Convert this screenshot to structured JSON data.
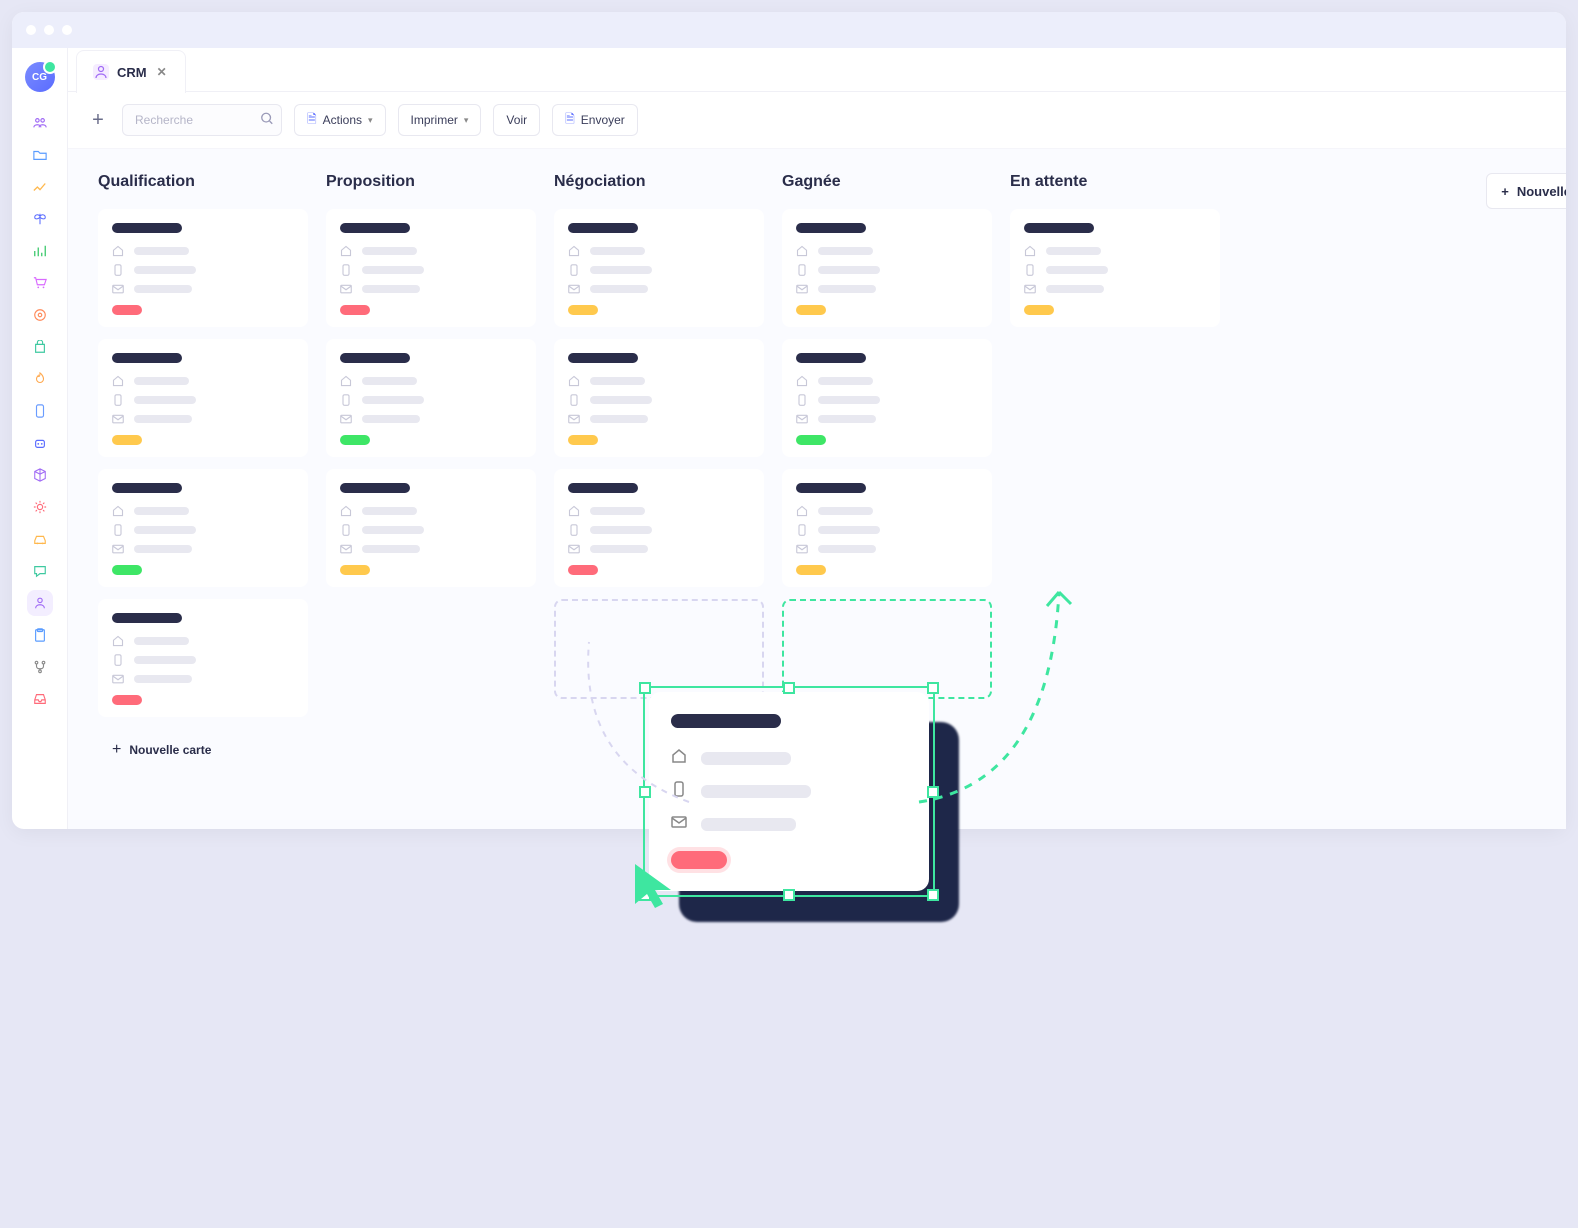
{
  "avatar": {
    "initials": "CG"
  },
  "tab": {
    "label": "CRM"
  },
  "toolbar": {
    "search_placeholder": "Recherche",
    "actions": "Actions",
    "print": "Imprimer",
    "view": "Voir",
    "send": "Envoyer"
  },
  "columns": [
    {
      "title": "Qualification",
      "cards": [
        {
          "pill": "red"
        },
        {
          "pill": "yellow"
        },
        {
          "pill": "green"
        },
        {
          "pill": "red"
        }
      ],
      "show_new_card": true
    },
    {
      "title": "Proposition",
      "cards": [
        {
          "pill": "red"
        },
        {
          "pill": "green"
        },
        {
          "pill": "yellow"
        }
      ]
    },
    {
      "title": "Négociation",
      "cards": [
        {
          "pill": "yellow"
        },
        {
          "pill": "yellow"
        },
        {
          "pill": "red"
        }
      ],
      "placeholder": "grey"
    },
    {
      "title": "Gagnée",
      "cards": [
        {
          "pill": "yellow"
        },
        {
          "pill": "green"
        },
        {
          "pill": "yellow"
        }
      ],
      "placeholder": "green"
    },
    {
      "title": "En attente",
      "cards": [
        {
          "pill": "yellow"
        }
      ]
    }
  ],
  "new_card_label": "Nouvelle carte",
  "new_column_label": "Nouvelle",
  "sidebar_icons": [
    {
      "name": "users-icon",
      "color": "#a06af5",
      "glyph": "people"
    },
    {
      "name": "folder-icon",
      "color": "#5a9cff",
      "glyph": "folder"
    },
    {
      "name": "trend-icon",
      "color": "#ffb84d",
      "glyph": "trend"
    },
    {
      "name": "butterfly-icon",
      "color": "#5a6cff",
      "glyph": "butterfly"
    },
    {
      "name": "chart-icon",
      "color": "#3ec96e",
      "glyph": "chart"
    },
    {
      "name": "cart-icon",
      "color": "#d96aff",
      "glyph": "cart"
    },
    {
      "name": "target-icon",
      "color": "#ff8a5a",
      "glyph": "target"
    },
    {
      "name": "bag-icon",
      "color": "#3ec9a0",
      "glyph": "bag"
    },
    {
      "name": "fire-icon",
      "color": "#ffa84d",
      "glyph": "fire"
    },
    {
      "name": "mobile-icon",
      "color": "#6a9cff",
      "glyph": "mobile"
    },
    {
      "name": "robot-icon",
      "color": "#5a6cff",
      "glyph": "robot"
    },
    {
      "name": "cube-icon",
      "color": "#a06af5",
      "glyph": "cube"
    },
    {
      "name": "gear-icon",
      "color": "#ff6b7a",
      "glyph": "gear"
    },
    {
      "name": "car-icon",
      "color": "#ffb84d",
      "glyph": "car"
    },
    {
      "name": "chat-icon",
      "color": "#3ec9a0",
      "glyph": "chat"
    },
    {
      "name": "person-icon",
      "color": "#a06af5",
      "glyph": "person",
      "active": true
    },
    {
      "name": "clipboard-icon",
      "color": "#5a9cff",
      "glyph": "clipboard"
    },
    {
      "name": "fork-icon",
      "color": "#888",
      "glyph": "fork"
    },
    {
      "name": "inbox-icon",
      "color": "#ff6b7a",
      "glyph": "inbox"
    }
  ]
}
